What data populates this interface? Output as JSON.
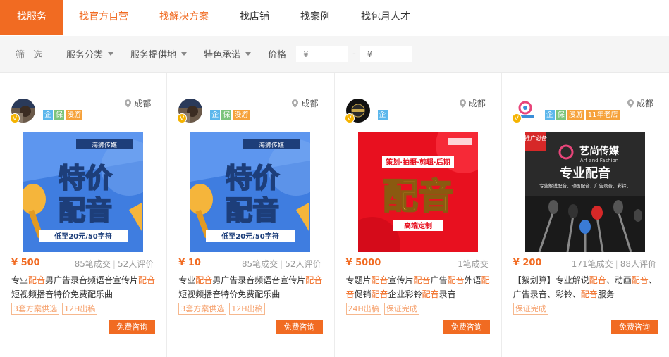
{
  "topnav": {
    "tabs": [
      {
        "label": "找服务"
      },
      {
        "label": "找官方自营"
      },
      {
        "label": "找解决方案"
      },
      {
        "label": "找店铺"
      },
      {
        "label": "找案例"
      },
      {
        "label": "找包月人才"
      }
    ]
  },
  "filter": {
    "label": "筛选",
    "dropdowns": [
      "服务分类",
      "服务提供地",
      "特色承诺"
    ],
    "price_label": "价格",
    "price_min_placeholder": "¥",
    "price_max_placeholder": "¥",
    "dash": "-"
  },
  "cards": [
    {
      "location": "成都",
      "tags": [
        "企",
        "保",
        "漫游"
      ],
      "image_text": {
        "brand": "海狮传媒",
        "line1": "特价",
        "line2": "配音",
        "banner": "低至20元/50字符"
      },
      "price": "¥ 500",
      "deals": "85笔成交",
      "reviews": "52人评价",
      "title_parts": [
        "专业",
        "配音",
        "男广告录音频语音宣传片",
        "配音",
        "短视频播音特价免费配乐曲"
      ],
      "badges": [
        "3套方案供选",
        "12H出稿"
      ],
      "consult": "免费咨询"
    },
    {
      "location": "成都",
      "tags": [
        "企",
        "保",
        "漫游"
      ],
      "image_text": {
        "brand": "海狮传媒",
        "line1": "特价",
        "line2": "配音",
        "banner": "低至20元/50字符"
      },
      "price": "¥ 10",
      "deals": "85笔成交",
      "reviews": "52人评价",
      "title_parts": [
        "专业",
        "配音",
        "男广告录音频语音宣传片",
        "配音",
        "短视频播音特价免费配乐曲"
      ],
      "badges": [
        "3套方案供选",
        "12H出稿"
      ],
      "consult": "免费咨询"
    },
    {
      "location": "成都",
      "tags": [
        "企"
      ],
      "image_text": {
        "top": "策划·拍摄·剪辑·后期",
        "main": "配音",
        "bottom": "高端定制"
      },
      "price": "¥ 5000",
      "deals": "1笔成交",
      "reviews": "",
      "title_parts": [
        "专题片",
        "配音",
        "宣传片",
        "配音",
        "广告",
        "配音",
        "外语",
        "配音",
        "促销",
        "配音",
        "企业彩铃",
        "配音",
        "录音"
      ],
      "badges": [
        "24H出稿",
        "保证完成"
      ],
      "consult": "免费咨询"
    },
    {
      "location": "成都",
      "tags": [
        "企",
        "保",
        "漫游",
        "11年老店"
      ],
      "image_text": {
        "corner": "推广必备",
        "brand": "艺尚传媒",
        "brand_en": "Art and Fashion",
        "main": "专业配音",
        "sub": "专业解说配音、动画配音、广告录音、彩铃、"
      },
      "price": "¥ 200",
      "deals": "171笔成交",
      "reviews": "88人评价",
      "title_parts": [
        "【絮划算】专业解说",
        "配音",
        "、动画",
        "配音",
        "、广告录音、彩铃、",
        "配音",
        "服务"
      ],
      "badges": [
        "保证完成"
      ],
      "consult": "免费咨询"
    }
  ],
  "colors": {
    "accent": "#f16b22",
    "tag_blue": "#5cb7ec",
    "tag_green": "#7cc47c",
    "tag_orange": "#f6a23b"
  }
}
